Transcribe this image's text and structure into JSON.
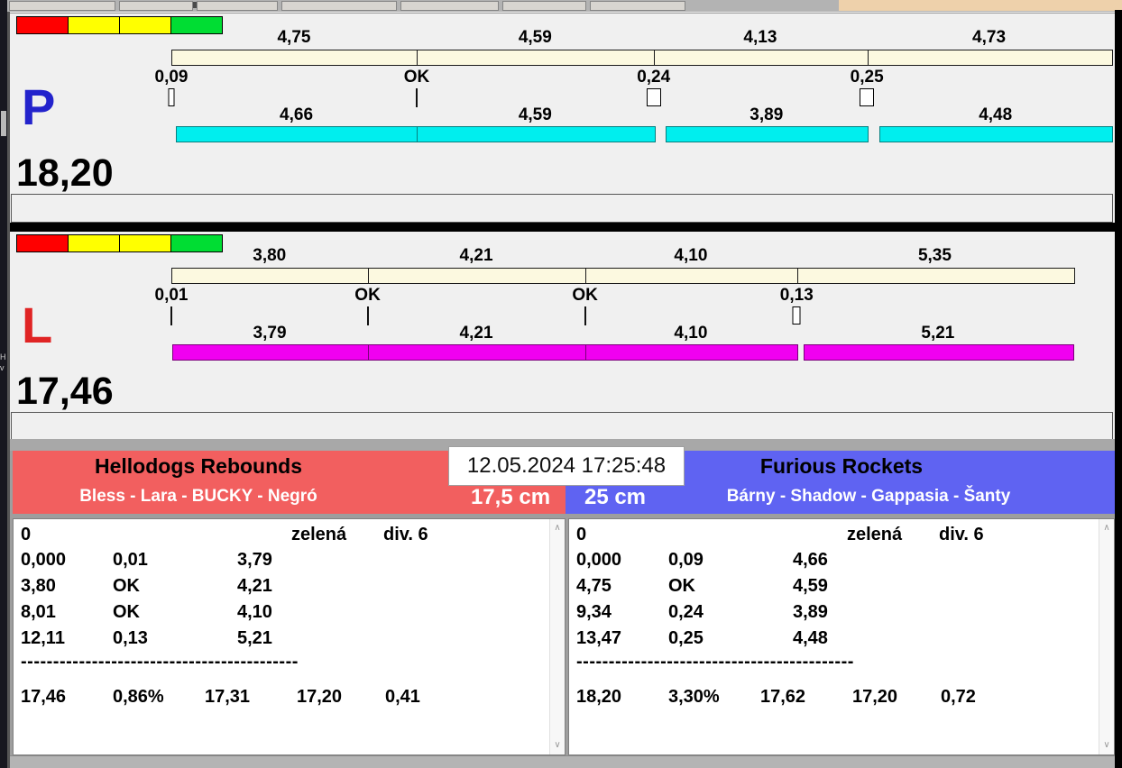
{
  "window": {
    "top_accent_color": "#eed1ab",
    "edge_marks": [
      "H",
      "v"
    ]
  },
  "lanes": [
    {
      "id": "P",
      "letter": "P",
      "letter_color": "#2323cc",
      "total": "18,20",
      "total_value": 18.2,
      "indicator_colors": [
        "#ff0000",
        "#ffff00",
        "#ffff00",
        "#00dd33"
      ],
      "bar_color": "#00eeee",
      "bar_border": "#067f7f",
      "top_segments": [
        {
          "label": "4,75",
          "value": 4.75
        },
        {
          "label": "4,59",
          "value": 4.59
        },
        {
          "label": "4,13",
          "value": 4.13
        },
        {
          "label": "4,73",
          "value": 4.73
        }
      ],
      "markers": [
        {
          "label": "0,09",
          "value": 0.09
        },
        {
          "label": "OK",
          "value": 0
        },
        {
          "label": "0,24",
          "value": 0.24
        },
        {
          "label": "0,25",
          "value": 0.25
        }
      ],
      "bottom_segments": [
        {
          "label": "4,66",
          "value": 4.66
        },
        {
          "label": "4,59",
          "value": 4.59
        },
        {
          "label": "3,89",
          "value": 3.89
        },
        {
          "label": "4,48",
          "value": 4.48
        }
      ]
    },
    {
      "id": "L",
      "letter": "L",
      "letter_color": "#e02424",
      "total": "17,46",
      "total_value": 17.46,
      "indicator_colors": [
        "#ff0000",
        "#ffff00",
        "#ffff00",
        "#00dd33"
      ],
      "bar_color": "#f000f0",
      "bar_border": "#7a007a",
      "top_segments": [
        {
          "label": "3,80",
          "value": 3.8
        },
        {
          "label": "4,21",
          "value": 4.21
        },
        {
          "label": "4,10",
          "value": 4.1
        },
        {
          "label": "5,35",
          "value": 5.35
        }
      ],
      "markers": [
        {
          "label": "0,01",
          "value": 0.01
        },
        {
          "label": "OK",
          "value": 0
        },
        {
          "label": "OK",
          "value": 0
        },
        {
          "label": "0,13",
          "value": 0.13
        }
      ],
      "bottom_segments": [
        {
          "label": "3,79",
          "value": 3.79
        },
        {
          "label": "4,21",
          "value": 4.21
        },
        {
          "label": "4,10",
          "value": 4.1
        },
        {
          "label": "5,21",
          "value": 5.21
        }
      ]
    }
  ],
  "scoreboard": {
    "datetime": "12.05.2024 17:25:48",
    "teams": [
      {
        "side": "left",
        "name": "Hellodogs Rebounds",
        "players": "Bless - Lara - BUCKY - Negró",
        "size": "17,5 cm",
        "color": "#f25f5f",
        "table": {
          "info_row": {
            "c1": "0",
            "c4": "zelená",
            "c5": "div. 6"
          },
          "rows": [
            [
              "0,000",
              "0,01",
              "3,79"
            ],
            [
              "3,80",
              "OK",
              "4,21"
            ],
            [
              "8,01",
              "OK",
              "4,10"
            ],
            [
              "12,11",
              "0,13",
              "5,21"
            ]
          ],
          "separator": "-------------------------------------------",
          "totals": [
            "17,46",
            "0,86%",
            "17,31",
            "17,20",
            "0,41"
          ]
        }
      },
      {
        "side": "right",
        "name": "Furious Rockets",
        "players": "Bárny - Shadow - Gappasia - Šanty",
        "size": "25 cm",
        "color": "#5f63f2",
        "table": {
          "info_row": {
            "c1": "0",
            "c4": "zelená",
            "c5": "div. 6"
          },
          "rows": [
            [
              "0,000",
              "0,09",
              "4,66"
            ],
            [
              "4,75",
              "OK",
              "4,59"
            ],
            [
              "9,34",
              "0,24",
              "3,89"
            ],
            [
              "13,47",
              "0,25",
              "4,48"
            ]
          ],
          "separator": "-------------------------------------------",
          "totals": [
            "18,20",
            "3,30%",
            "17,62",
            "17,20",
            "0,72"
          ]
        }
      }
    ]
  }
}
